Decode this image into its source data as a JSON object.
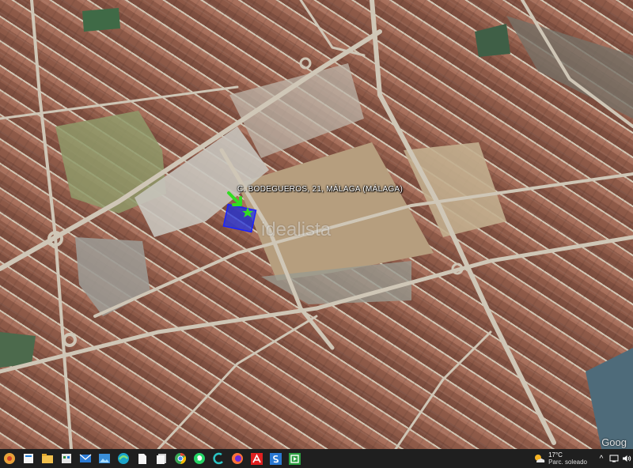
{
  "map": {
    "address_label": "C. BODEGUEROS, 21, MÁLAGA (MÁLAGA)",
    "watermark": "idealista",
    "provider_logo": "Goog",
    "marker_color": "#2233dd",
    "pointer_color": "#33dd22"
  },
  "taskbar": {
    "icons": [
      "windows-start-icon",
      "search-icon",
      "file-explorer-icon",
      "store-icon",
      "mail-icon",
      "photos-icon",
      "edge-icon",
      "document-icon",
      "files-icon",
      "chrome-icon",
      "whatsapp-icon",
      "cortana-icon",
      "firefox-icon",
      "acrobat-icon",
      "app-s-icon",
      "app-green-icon"
    ],
    "weather": {
      "temperature": "17°C",
      "description": "Parc. soleado"
    },
    "tray": {
      "chevron": "^",
      "network": "network-icon",
      "volume": "volume-icon"
    }
  }
}
